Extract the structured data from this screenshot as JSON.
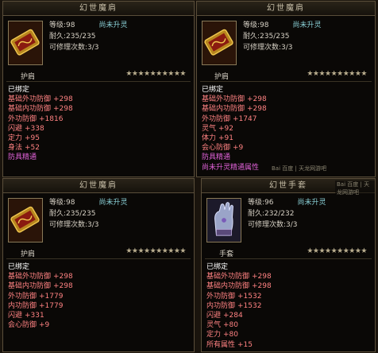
{
  "panels": [
    {
      "title": "幻世魔肩",
      "level": "等级:98",
      "status": "尚未升灵",
      "durability": "耐久:235/235",
      "repair": "可修理次数:3/3",
      "type_name": "护肩",
      "stars": "★★★★★★★★★★",
      "bound": "已绑定",
      "stats": [
        {
          "label": "基础外功防御",
          "value": "+298",
          "color": "red"
        },
        {
          "label": "基础内功防御",
          "value": "+298",
          "color": "red"
        },
        {
          "label": "外功防御",
          "value": "+1816",
          "color": "red"
        },
        {
          "label": "闪避",
          "value": "+338",
          "color": "red"
        },
        {
          "label": "定力",
          "value": "+95",
          "color": "red"
        },
        {
          "label": "身法",
          "value": "+52",
          "color": "red"
        },
        {
          "label": "防具精通",
          "value": "",
          "color": "pink"
        }
      ]
    },
    {
      "title": "幻世魔肩",
      "level": "等级:98",
      "status": "尚未升灵",
      "durability": "耐久:235/235",
      "repair": "可修理次数:3/3",
      "type_name": "护肩",
      "stars": "★★★★★★★★★★",
      "bound": "已绑定",
      "stats": [
        {
          "label": "基础外功防御",
          "value": "+298",
          "color": "red"
        },
        {
          "label": "基础内功防御",
          "value": "+298",
          "color": "red"
        },
        {
          "label": "外功防御",
          "value": "+1747",
          "color": "red"
        },
        {
          "label": "灵气",
          "value": "+92",
          "color": "red"
        },
        {
          "label": "体力",
          "value": "+91",
          "color": "red"
        },
        {
          "label": "会心防御",
          "value": "+9",
          "color": "red"
        },
        {
          "label": "防具精通",
          "value": "",
          "color": "pink"
        },
        {
          "label": "尚未升灵精通属性",
          "value": "",
          "color": "pink"
        }
      ]
    },
    {
      "title": "幻世魔肩",
      "level": "等级:98",
      "status": "尚未升灵",
      "durability": "耐久:235/235",
      "repair": "可修理次数:3/3",
      "type_name": "护肩",
      "stars": "★★★★★★★★★★",
      "bound": "已绑定",
      "stats": [
        {
          "label": "基础外功防御",
          "value": "+298",
          "color": "red"
        },
        {
          "label": "基础内功防御",
          "value": "+298",
          "color": "red"
        },
        {
          "label": "外功防御",
          "value": "+1779",
          "color": "red"
        },
        {
          "label": "内功防御",
          "value": "+1779",
          "color": "red"
        },
        {
          "label": "闪避",
          "value": "+331",
          "color": "red"
        },
        {
          "label": "会心防御",
          "value": "+9",
          "color": "red"
        }
      ]
    },
    {
      "title": "幻世手套",
      "level": "等级:96",
      "status": "尚未升灵",
      "durability": "耐久:232/232",
      "repair": "可修理次数:3/3",
      "type_name": "手套",
      "stars": "★★★★★★★★★★",
      "bound": "已绑定",
      "stats": [
        {
          "label": "基础外功防御",
          "value": "+298",
          "color": "red"
        },
        {
          "label": "基础内功防御",
          "value": "+298",
          "color": "red"
        },
        {
          "label": "外功防御",
          "value": "+1532",
          "color": "red"
        },
        {
          "label": "内功防御",
          "value": "+1532",
          "color": "red"
        },
        {
          "label": "闪避",
          "value": "+284",
          "color": "red"
        },
        {
          "label": "灵气",
          "value": "+80",
          "color": "red"
        },
        {
          "label": "定力",
          "value": "+80",
          "color": "red"
        },
        {
          "label": "所有属性",
          "value": "+15",
          "color": "red"
        }
      ]
    }
  ],
  "watermarks": [
    "Bai 百度 | 天龙网游吧",
    "Bai 百度 | 天龙网游吧"
  ],
  "icons": [
    "shoulder-pad-icon",
    "shoulder-pad-icon",
    "shoulder-pad-icon",
    "gauntlet-icon"
  ],
  "colors": {
    "stat_red": "#ff8282",
    "stat_pink": "#e062d8",
    "status_cyan": "#8ad0d6",
    "frame": "#5a4e3a"
  }
}
